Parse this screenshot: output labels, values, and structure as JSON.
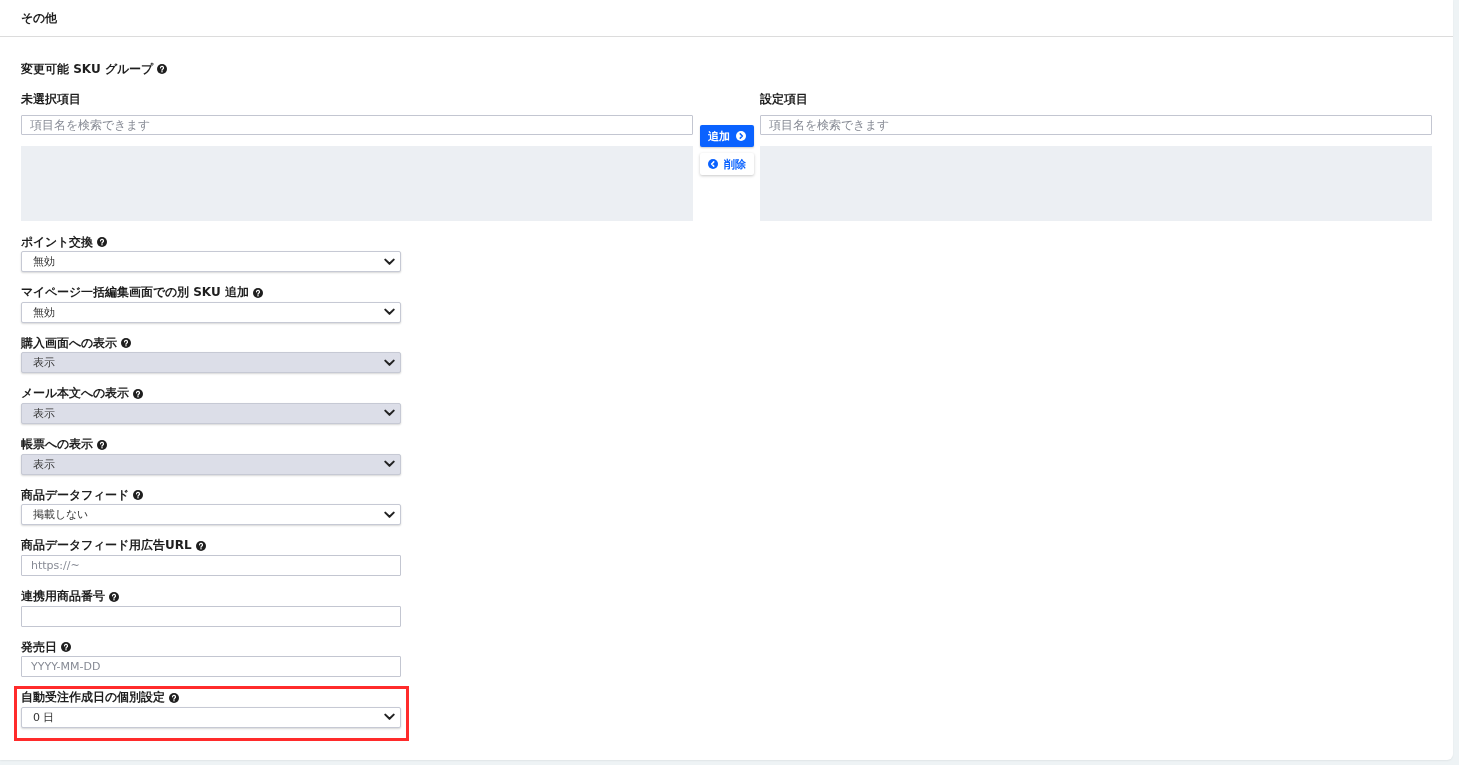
{
  "section": {
    "title": "その他"
  },
  "sku_group": {
    "label": "変更可能 SKU グループ",
    "available": {
      "label": "未選択項目",
      "search": {
        "placeholder": "項目名を検索できます"
      }
    },
    "buttons": [
      {
        "label": "追加",
        "kind": "add"
      },
      {
        "label": "削除",
        "kind": "remove"
      }
    ],
    "assigned": {
      "label": "設定項目",
      "search": {
        "placeholder": "項目名を検索できます"
      }
    }
  },
  "fields": [
    {
      "label": "ポイント交換",
      "kind": "select",
      "value": "無効",
      "disabled": false,
      "highlighted": false
    },
    {
      "label": "マイページ一括編集画面での別 SKU 追加",
      "kind": "select",
      "value": "無効",
      "disabled": false,
      "highlighted": false
    },
    {
      "label": "購入画面への表示",
      "kind": "select",
      "value": "表示",
      "disabled": true,
      "highlighted": false
    },
    {
      "label": "メール本文への表示",
      "kind": "select",
      "value": "表示",
      "disabled": true,
      "highlighted": false
    },
    {
      "label": "帳票への表示",
      "kind": "select",
      "value": "表示",
      "disabled": true,
      "highlighted": false
    },
    {
      "label": "商品データフィード",
      "kind": "select",
      "value": "掲載しない",
      "disabled": false,
      "highlighted": false
    },
    {
      "label": "商品データフィード用広告URL",
      "kind": "input",
      "placeholder": "https://~",
      "disabled": false,
      "highlighted": false
    },
    {
      "label": "連携用商品番号",
      "kind": "input",
      "disabled": false,
      "highlighted": false
    },
    {
      "label": "発売日",
      "kind": "input",
      "placeholder": "YYYY-MM-DD",
      "disabled": false,
      "highlighted": false
    },
    {
      "label": "自動受注作成日の個別設定",
      "kind": "select",
      "value": "0 日",
      "disabled": false,
      "highlighted": true
    }
  ]
}
